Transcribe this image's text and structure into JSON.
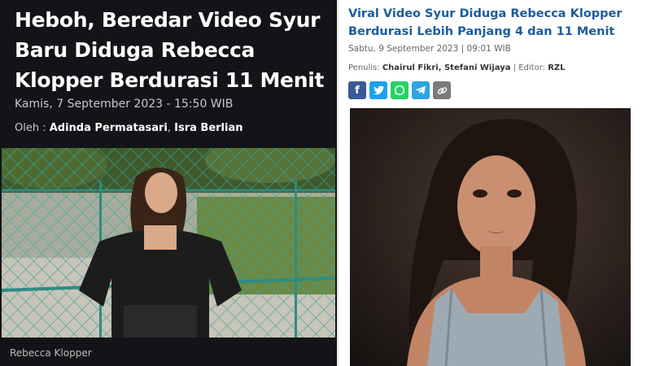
{
  "left_article": {
    "title": "Heboh, Beredar Video Syur Baru Diduga Rebecca Klopper Berdurasi 11 Menit",
    "date": "Kamis, 7 September 2023 - 15:50 WIB",
    "byline_prefix": "Oleh :",
    "authors": [
      "Adinda Permatasari",
      "Isra Berlian"
    ],
    "photo_caption": "Rebecca Klopper"
  },
  "right_article": {
    "title": "Viral Video Syur Diduga Rebecca Klopper Berdurasi Lebih Panjang 4 dan 11 Menit",
    "date": "Sabtu, 9 September 2023 | 09:01 WIB",
    "writer_label": "Penulis:",
    "writers": "Chairul Fikri, Stefani Wijaya",
    "editor_label": "| Editor:",
    "editor": "RZL",
    "share_buttons": [
      {
        "icon": "facebook-icon",
        "color": "#3b5998"
      },
      {
        "icon": "twitter-icon",
        "color": "#1da1f2"
      },
      {
        "icon": "whatsapp-icon",
        "color": "#25d366"
      },
      {
        "icon": "telegram-icon",
        "color": "#2ca5e0"
      },
      {
        "icon": "link-icon",
        "color": "#7a7a7a"
      }
    ]
  },
  "colors": {
    "left_bg": "#131417",
    "right_title": "#1d5c9b"
  }
}
